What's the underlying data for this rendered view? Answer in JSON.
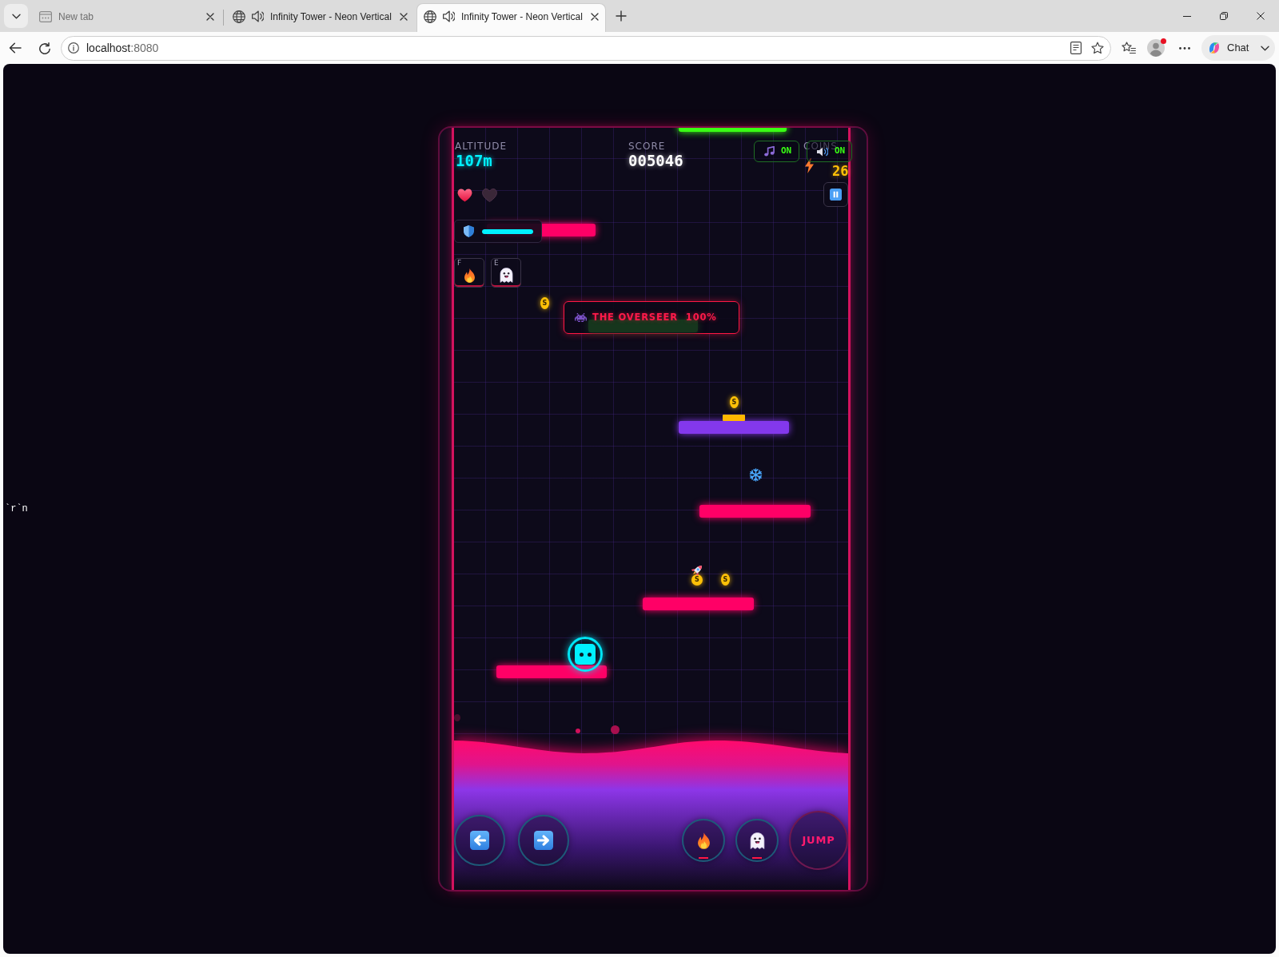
{
  "browser": {
    "tabs": [
      {
        "kind": "blank",
        "title": "New tab",
        "audio": false,
        "selected": false
      },
      {
        "kind": "page",
        "title": "Infinity Tower - Neon Vertical",
        "audio": true,
        "selected": false
      },
      {
        "kind": "page",
        "title": "Infinity Tower - Neon Vertical",
        "audio": true,
        "selected": true
      }
    ],
    "address": {
      "host": "localhost",
      "port": ":8080"
    },
    "profile_alert": true,
    "chat_label": "Chat"
  },
  "page_text": "`r`n",
  "hud": {
    "altitude": {
      "label": "ALTITUDE",
      "value": "107m"
    },
    "score": {
      "label": "SCORE",
      "value": "005046"
    },
    "coins": {
      "label": "COINS",
      "value": "26"
    },
    "toggles": [
      {
        "kind": "music",
        "label": "ON",
        "on": true
      },
      {
        "kind": "sound",
        "label": "ON",
        "on": true
      }
    ],
    "lives": [
      {
        "filled": true
      },
      {
        "filled": false
      }
    ],
    "shield": {
      "level": 1
    },
    "powerups": [
      {
        "kind": "fire",
        "key": "F"
      },
      {
        "kind": "ghost",
        "key": "E"
      }
    ]
  },
  "boss": {
    "name": "THE OVERSEER",
    "health": "100%"
  },
  "world": {
    "platforms": [
      {
        "color": "#39ff14",
        "spring": false
      },
      {
        "color": "#ff0066",
        "spring": false
      },
      {
        "color": "#16361d",
        "spring": false
      },
      {
        "color": "#8338ec",
        "spring": true
      },
      {
        "color": "#ff0066",
        "spring": false
      },
      {
        "color": "#ff0066",
        "spring": false
      },
      {
        "color": "#ff0066",
        "spring": false
      }
    ],
    "coins": [
      {
        "symbol": "S"
      },
      {
        "symbol": "S"
      },
      {
        "symbol": "S"
      },
      {
        "symbol": "S"
      }
    ],
    "pickups": [
      {
        "kind": "freeze"
      },
      {
        "kind": "rocket"
      }
    ]
  },
  "controls": [
    {
      "kind": "left"
    },
    {
      "kind": "right"
    },
    {
      "kind": "fire"
    },
    {
      "kind": "ghost"
    },
    {
      "kind": "jump",
      "label": "JUMP"
    }
  ]
}
